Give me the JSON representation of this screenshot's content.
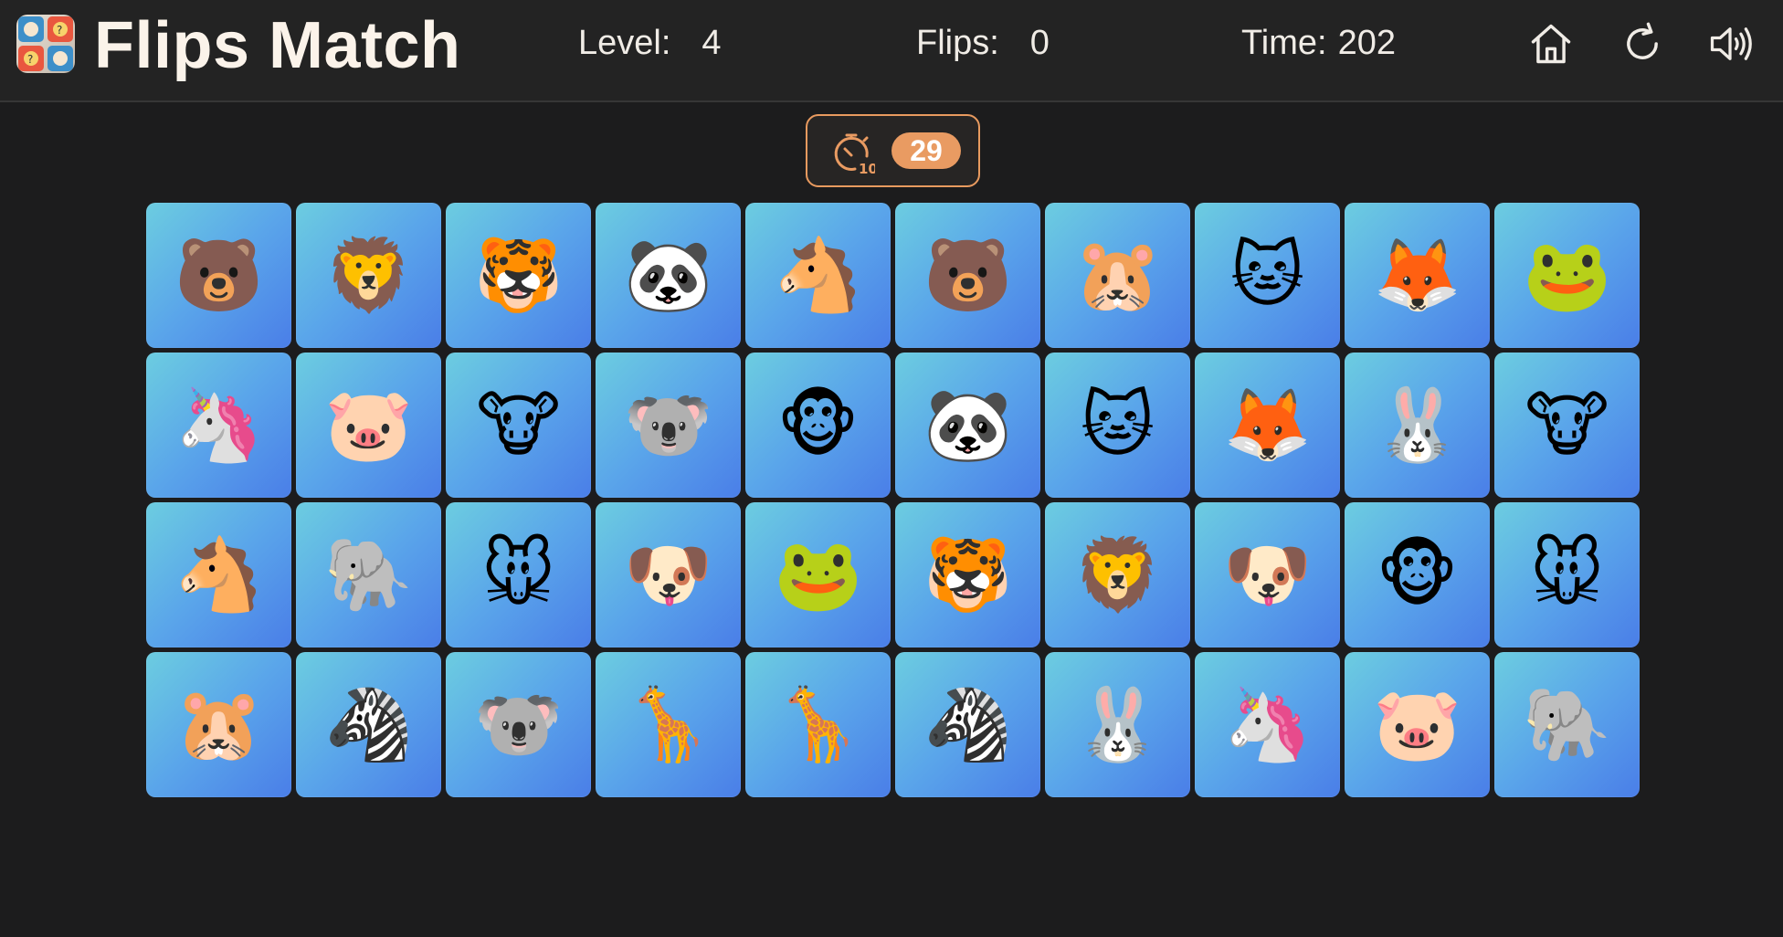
{
  "header": {
    "title": "Flips Match",
    "logo_icon": "game-logo",
    "level_label": "Level:",
    "level_value": "4",
    "flips_label": "Flips:",
    "flips_value": "0",
    "time_label": "Time:",
    "time_value": "202",
    "icons": [
      "home-icon",
      "restart-icon",
      "sound-icon"
    ]
  },
  "countdown": {
    "icon": "stopwatch-10-icon",
    "value": "29",
    "accent": "#e99b62"
  },
  "colors": {
    "background": "#1c1c1d",
    "header_background": "#232323",
    "card_gradient_start": "#6ccde0",
    "card_gradient_end": "#4a7ee8"
  },
  "board": {
    "columns": 10,
    "rows": 4,
    "cards": [
      {
        "animal": "bear",
        "emoji": "🐻"
      },
      {
        "animal": "lion",
        "emoji": "🦁"
      },
      {
        "animal": "tiger",
        "emoji": "🐯"
      },
      {
        "animal": "panda",
        "emoji": "🐼"
      },
      {
        "animal": "horse",
        "emoji": "🐴"
      },
      {
        "animal": "bear",
        "emoji": "🐻"
      },
      {
        "animal": "hamster",
        "emoji": "🐹"
      },
      {
        "animal": "cat",
        "emoji": "🐱"
      },
      {
        "animal": "fox",
        "emoji": "🦊"
      },
      {
        "animal": "frog",
        "emoji": "🐸"
      },
      {
        "animal": "unicorn",
        "emoji": "🦄"
      },
      {
        "animal": "pig",
        "emoji": "🐷"
      },
      {
        "animal": "cow",
        "emoji": "🐮"
      },
      {
        "animal": "koala",
        "emoji": "🐨"
      },
      {
        "animal": "monkey",
        "emoji": "🐵"
      },
      {
        "animal": "panda",
        "emoji": "🐼"
      },
      {
        "animal": "cat",
        "emoji": "🐱"
      },
      {
        "animal": "fox",
        "emoji": "🦊"
      },
      {
        "animal": "rabbit",
        "emoji": "🐰"
      },
      {
        "animal": "cow",
        "emoji": "🐮"
      },
      {
        "animal": "horse",
        "emoji": "🐴"
      },
      {
        "animal": "elephant",
        "emoji": "🐘"
      },
      {
        "animal": "mouse",
        "emoji": "🐭"
      },
      {
        "animal": "dog",
        "emoji": "🐶"
      },
      {
        "animal": "frog",
        "emoji": "🐸"
      },
      {
        "animal": "tiger",
        "emoji": "🐯"
      },
      {
        "animal": "lion",
        "emoji": "🦁"
      },
      {
        "animal": "dog",
        "emoji": "🐶"
      },
      {
        "animal": "monkey",
        "emoji": "🐵"
      },
      {
        "animal": "mouse",
        "emoji": "🐭"
      },
      {
        "animal": "hamster",
        "emoji": "🐹"
      },
      {
        "animal": "zebra",
        "emoji": "🦓"
      },
      {
        "animal": "koala",
        "emoji": "🐨"
      },
      {
        "animal": "giraffe",
        "emoji": "🦒"
      },
      {
        "animal": "giraffe",
        "emoji": "🦒"
      },
      {
        "animal": "zebra",
        "emoji": "🦓"
      },
      {
        "animal": "rabbit",
        "emoji": "🐰"
      },
      {
        "animal": "unicorn",
        "emoji": "🦄"
      },
      {
        "animal": "pig",
        "emoji": "🐷"
      },
      {
        "animal": "elephant",
        "emoji": "🐘"
      }
    ]
  }
}
